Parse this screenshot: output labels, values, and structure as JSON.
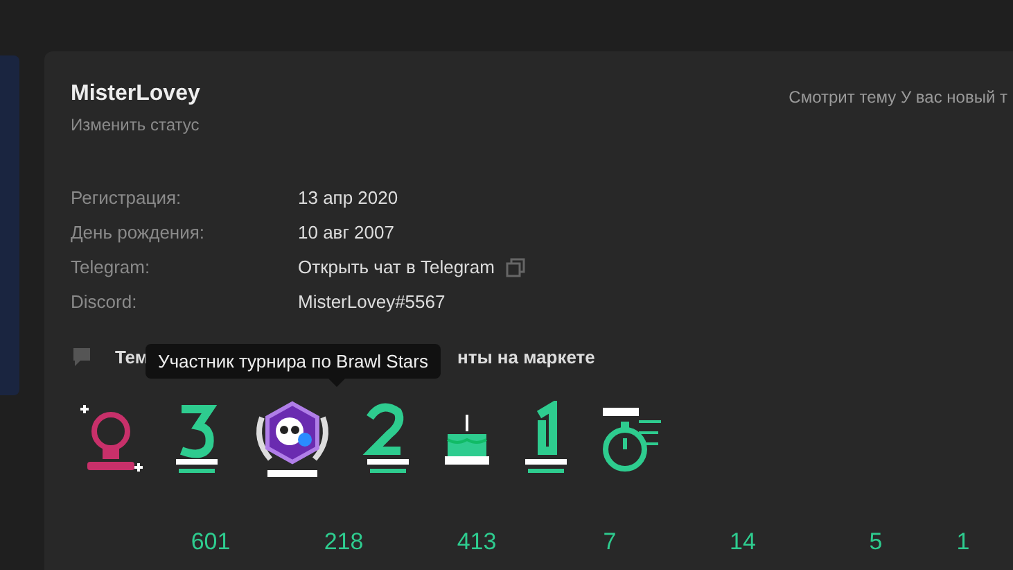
{
  "profile": {
    "username": "MisterLovey",
    "status_link": "Изменить статус",
    "activity": "Смотрит тему У вас новый т"
  },
  "info": [
    {
      "label": "Регистрация:",
      "value": "13 апр 2020",
      "kind": "text"
    },
    {
      "label": "День рождения:",
      "value": "10 авг 2007",
      "kind": "text"
    },
    {
      "label": "Telegram:",
      "value": "Открыть чат в Telegram",
      "kind": "link"
    },
    {
      "label": "Discord:",
      "value": "MisterLovey#5567",
      "kind": "text"
    }
  ],
  "links": [
    "Тем",
    "нты на маркете"
  ],
  "tooltip": "Участник турнира по Brawl Stars",
  "badges": [
    {
      "kind": "bulb"
    },
    {
      "kind": "years3"
    },
    {
      "kind": "tournament"
    },
    {
      "kind": "years2"
    },
    {
      "kind": "cake"
    },
    {
      "kind": "year1"
    },
    {
      "kind": "stopwatch"
    }
  ],
  "stats": [
    "601",
    "218",
    "413",
    "7",
    "14",
    "5",
    "1"
  ]
}
